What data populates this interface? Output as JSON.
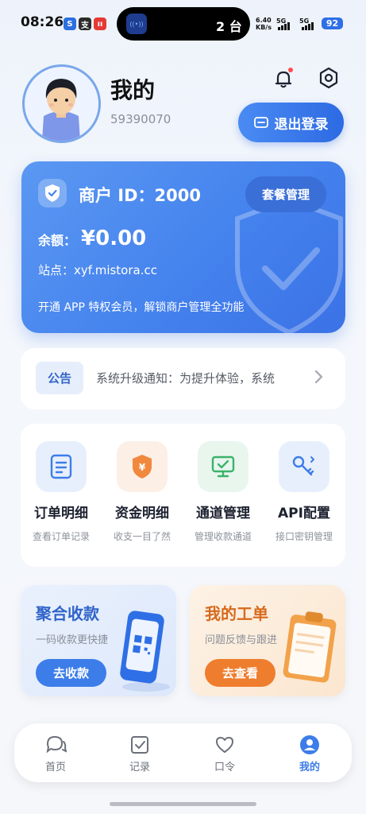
{
  "status": {
    "time": "08:26",
    "island_label": "2 台",
    "island_icon_text": "((•))",
    "net_speed": "6.40",
    "net_unit": "KB/s",
    "signal1": "5G",
    "signal2": "5G",
    "battery": "92",
    "app_icons": [
      {
        "name": "app-icon-s",
        "text": "S",
        "color": "#2b6fe0"
      },
      {
        "name": "app-icon-zhi",
        "text": "支",
        "color": "#2b2b2b"
      },
      {
        "name": "app-icon-red",
        "text": "ıı",
        "color": "#e53935"
      }
    ]
  },
  "profile": {
    "title": "我的",
    "user_id": "59390070",
    "logout_label": "退出登录"
  },
  "merchant": {
    "title": "商户 ID：2000",
    "package_button": "套餐管理",
    "balance_label": "余额：",
    "balance_value": "¥0.00",
    "site": "站点：xyf.mistora.cc",
    "promo": "开通 APP 特权会员，解锁商户管理全功能"
  },
  "notice": {
    "tag": "公告",
    "text": "系统升级通知：为提升体验，系统"
  },
  "menu": [
    {
      "title": "订单明细",
      "subtitle": "查看订单记录",
      "icon": "order-list-icon",
      "bg": "#e8effc"
    },
    {
      "title": "资金明细",
      "subtitle": "收支一目了然",
      "icon": "fund-shield-icon",
      "bg": "#fcefe6"
    },
    {
      "title": "通道管理",
      "subtitle": "管理收款通道",
      "icon": "channel-monitor-icon",
      "bg": "#e8f6ee"
    },
    {
      "title": "API配置",
      "subtitle": "接口密钥管理",
      "icon": "api-key-icon",
      "bg": "#e8effc"
    }
  ],
  "features": {
    "collect": {
      "title": "聚合收款",
      "subtitle": "一码收款更快捷",
      "button": "去收款",
      "color": "#3d7de9"
    },
    "ticket": {
      "title": "我的工单",
      "subtitle": "问题反馈与跟进",
      "button": "去查看",
      "color": "#ee7d2e"
    }
  },
  "tabs": [
    {
      "label": "首页",
      "icon": "chat-bubble-icon"
    },
    {
      "label": "记录",
      "icon": "checkbox-icon"
    },
    {
      "label": "口令",
      "icon": "heart-icon"
    },
    {
      "label": "我的",
      "icon": "user-icon",
      "active": true
    }
  ],
  "colors": {
    "accent": "#3d7de9",
    "orange": "#ee7d2e"
  }
}
